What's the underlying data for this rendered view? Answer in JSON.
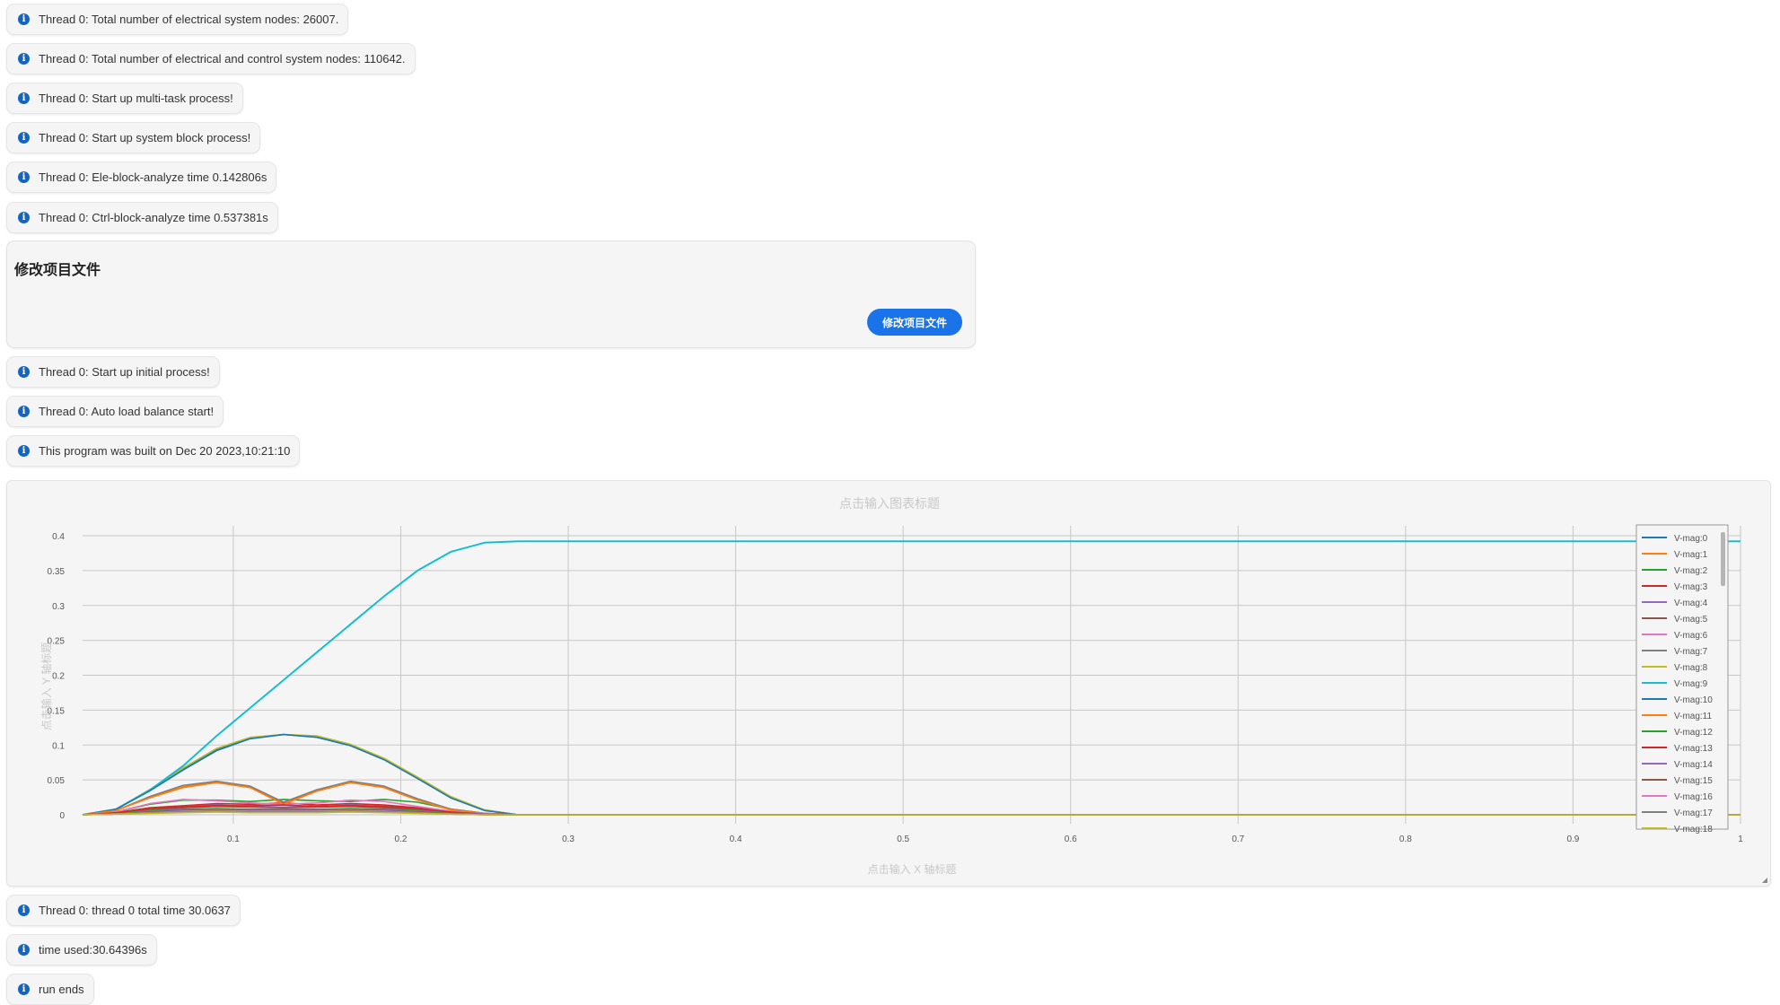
{
  "notices_top": [
    "Thread 0: Total number of electrical system nodes: 26007.",
    "Thread 0: Total number of electrical and control system nodes: 110642.",
    "Thread 0: Start up multi-task process!",
    "Thread 0: Start up system block process!",
    "Thread 0: Ele-block-analyze time 0.142806s",
    "Thread 0: Ctrl-block-analyze time 0.537381s"
  ],
  "edit_panel": {
    "title": "修改项目文件",
    "button_label": "修改项目文件",
    "button_color": "#1a73e8"
  },
  "notices_mid": [
    "Thread 0: Start up initial process!",
    "Thread 0: Auto load balance start!",
    "This program was built on Dec 20 2023,10:21:10"
  ],
  "notices_bottom": [
    "Thread 0: thread 0 total time 30.0637",
    "time used:30.64396s",
    "run ends"
  ],
  "icons": {
    "notice": "info-circle-icon"
  },
  "chart_data": {
    "type": "line",
    "title": "点击输入图表标题",
    "xlabel": "点击输入 X 轴标题",
    "ylabel": "点击输入 Y 轴标题",
    "xlim": [
      0.01,
      1
    ],
    "ylim": [
      0,
      0.4
    ],
    "xticks": [
      "0.1",
      "0.2",
      "0.3",
      "0.4",
      "0.5",
      "0.6",
      "0.7",
      "0.8",
      "0.9",
      "1"
    ],
    "yticks": [
      "0",
      "0.05",
      "0.1",
      "0.15",
      "0.2",
      "0.25",
      "0.3",
      "0.35",
      "0.4"
    ],
    "grid": true,
    "legend_position": "right",
    "x": [
      0.01,
      0.03,
      0.05,
      0.07,
      0.09,
      0.11,
      0.13,
      0.15,
      0.17,
      0.19,
      0.21,
      0.23,
      0.25,
      0.27,
      0.3,
      0.5,
      0.7,
      1.0
    ],
    "series": [
      {
        "name": "V-mag:0",
        "color": "#1f77b4",
        "values": [
          0,
          0.008,
          0.035,
          0.065,
          0.093,
          0.11,
          0.115,
          0.112,
          0.1,
          0.08,
          0.053,
          0.025,
          0.007,
          0,
          0,
          0,
          0,
          0
        ]
      },
      {
        "name": "V-mag:1",
        "color": "#ff7f0e",
        "values": [
          0,
          0.006,
          0.025,
          0.04,
          0.047,
          0.04,
          0.016,
          0.035,
          0.047,
          0.04,
          0.022,
          0.008,
          0.002,
          0,
          0,
          0,
          0,
          0
        ]
      },
      {
        "name": "V-mag:2",
        "color": "#2ca02c",
        "values": [
          0,
          0.004,
          0.015,
          0.021,
          0.021,
          0.019,
          0.022,
          0.02,
          0.019,
          0.022,
          0.018,
          0.008,
          0.002,
          0,
          0,
          0,
          0,
          0
        ]
      },
      {
        "name": "V-mag:3",
        "color": "#d62728",
        "values": [
          0,
          0.003,
          0.01,
          0.013,
          0.016,
          0.015,
          0.017,
          0.014,
          0.016,
          0.014,
          0.01,
          0.005,
          0.001,
          0,
          0,
          0,
          0,
          0
        ]
      },
      {
        "name": "V-mag:4",
        "color": "#9467bd",
        "values": [
          0,
          0.002,
          0.008,
          0.012,
          0.014,
          0.012,
          0.011,
          0.012,
          0.014,
          0.012,
          0.008,
          0.004,
          0.001,
          0,
          0,
          0,
          0,
          0
        ]
      },
      {
        "name": "V-mag:5",
        "color": "#8c564b",
        "values": [
          0,
          0.002,
          0.007,
          0.01,
          0.012,
          0.011,
          0.01,
          0.011,
          0.012,
          0.01,
          0.007,
          0.003,
          0.001,
          0,
          0,
          0,
          0,
          0
        ]
      },
      {
        "name": "V-mag:6",
        "color": "#e377c2",
        "values": [
          0,
          0.004,
          0.016,
          0.022,
          0.02,
          0.017,
          0.015,
          0.017,
          0.021,
          0.019,
          0.012,
          0.005,
          0.001,
          0,
          0,
          0,
          0,
          0
        ]
      },
      {
        "name": "V-mag:7",
        "color": "#7f7f7f",
        "values": [
          0,
          0.006,
          0.026,
          0.042,
          0.048,
          0.041,
          0.018,
          0.036,
          0.048,
          0.041,
          0.023,
          0.008,
          0.002,
          0,
          0,
          0,
          0,
          0
        ]
      },
      {
        "name": "V-mag:8",
        "color": "#bcbd22",
        "values": [
          0,
          0.008,
          0.036,
          0.067,
          0.095,
          0.111,
          0.115,
          0.113,
          0.101,
          0.081,
          0.054,
          0.026,
          0.007,
          0,
          0,
          0,
          0,
          0
        ]
      },
      {
        "name": "V-mag:9",
        "color": "#17becf",
        "values": [
          0,
          0.008,
          0.035,
          0.07,
          0.113,
          0.153,
          0.193,
          0.233,
          0.273,
          0.313,
          0.35,
          0.377,
          0.39,
          0.392,
          0.392,
          0.392,
          0.392,
          0.392
        ]
      },
      {
        "name": "V-mag:10",
        "color": "#1f77b4",
        "values": [
          0,
          0.008,
          0.034,
          0.064,
          0.092,
          0.109,
          0.115,
          0.111,
          0.099,
          0.079,
          0.052,
          0.024,
          0.006,
          0,
          0,
          0,
          0,
          0
        ]
      },
      {
        "name": "V-mag:11",
        "color": "#ff7f0e",
        "values": [
          0,
          0.006,
          0.024,
          0.039,
          0.046,
          0.039,
          0.015,
          0.034,
          0.046,
          0.039,
          0.021,
          0.007,
          0.002,
          0,
          0,
          0,
          0,
          0
        ]
      },
      {
        "name": "V-mag:12",
        "color": "#2ca02c",
        "values": [
          0,
          0.002,
          0.006,
          0.008,
          0.009,
          0.008,
          0.008,
          0.008,
          0.009,
          0.008,
          0.006,
          0.003,
          0.001,
          0,
          0,
          0,
          0,
          0
        ]
      },
      {
        "name": "V-mag:13",
        "color": "#d62728",
        "values": [
          0,
          0.003,
          0.009,
          0.012,
          0.013,
          0.013,
          0.014,
          0.012,
          0.013,
          0.012,
          0.009,
          0.004,
          0.001,
          0,
          0,
          0,
          0,
          0
        ]
      },
      {
        "name": "V-mag:14",
        "color": "#9467bd",
        "values": [
          0,
          0.001,
          0.005,
          0.007,
          0.008,
          0.007,
          0.007,
          0.007,
          0.008,
          0.007,
          0.005,
          0.002,
          0.001,
          0,
          0,
          0,
          0,
          0
        ]
      },
      {
        "name": "V-mag:15",
        "color": "#8c564b",
        "values": [
          0,
          0.001,
          0.004,
          0.006,
          0.007,
          0.006,
          0.006,
          0.006,
          0.007,
          0.006,
          0.004,
          0.002,
          0,
          0,
          0,
          0,
          0,
          0
        ]
      },
      {
        "name": "V-mag:16",
        "color": "#e377c2",
        "values": [
          0,
          0.001,
          0.003,
          0.005,
          0.006,
          0.005,
          0.005,
          0.005,
          0.006,
          0.005,
          0.003,
          0.001,
          0,
          0,
          0,
          0,
          0,
          0
        ]
      },
      {
        "name": "V-mag:17",
        "color": "#7f7f7f",
        "values": [
          0,
          0.001,
          0.003,
          0.004,
          0.005,
          0.004,
          0.004,
          0.004,
          0.005,
          0.004,
          0.003,
          0.001,
          0,
          0,
          0,
          0,
          0,
          0
        ]
      },
      {
        "name": "V-mag:18",
        "color": "#bcbd22",
        "values": [
          0,
          0.001,
          0.002,
          0.003,
          0.004,
          0.003,
          0.003,
          0.003,
          0.004,
          0.003,
          0.002,
          0.001,
          0,
          0,
          0,
          0,
          0,
          0
        ]
      }
    ]
  }
}
